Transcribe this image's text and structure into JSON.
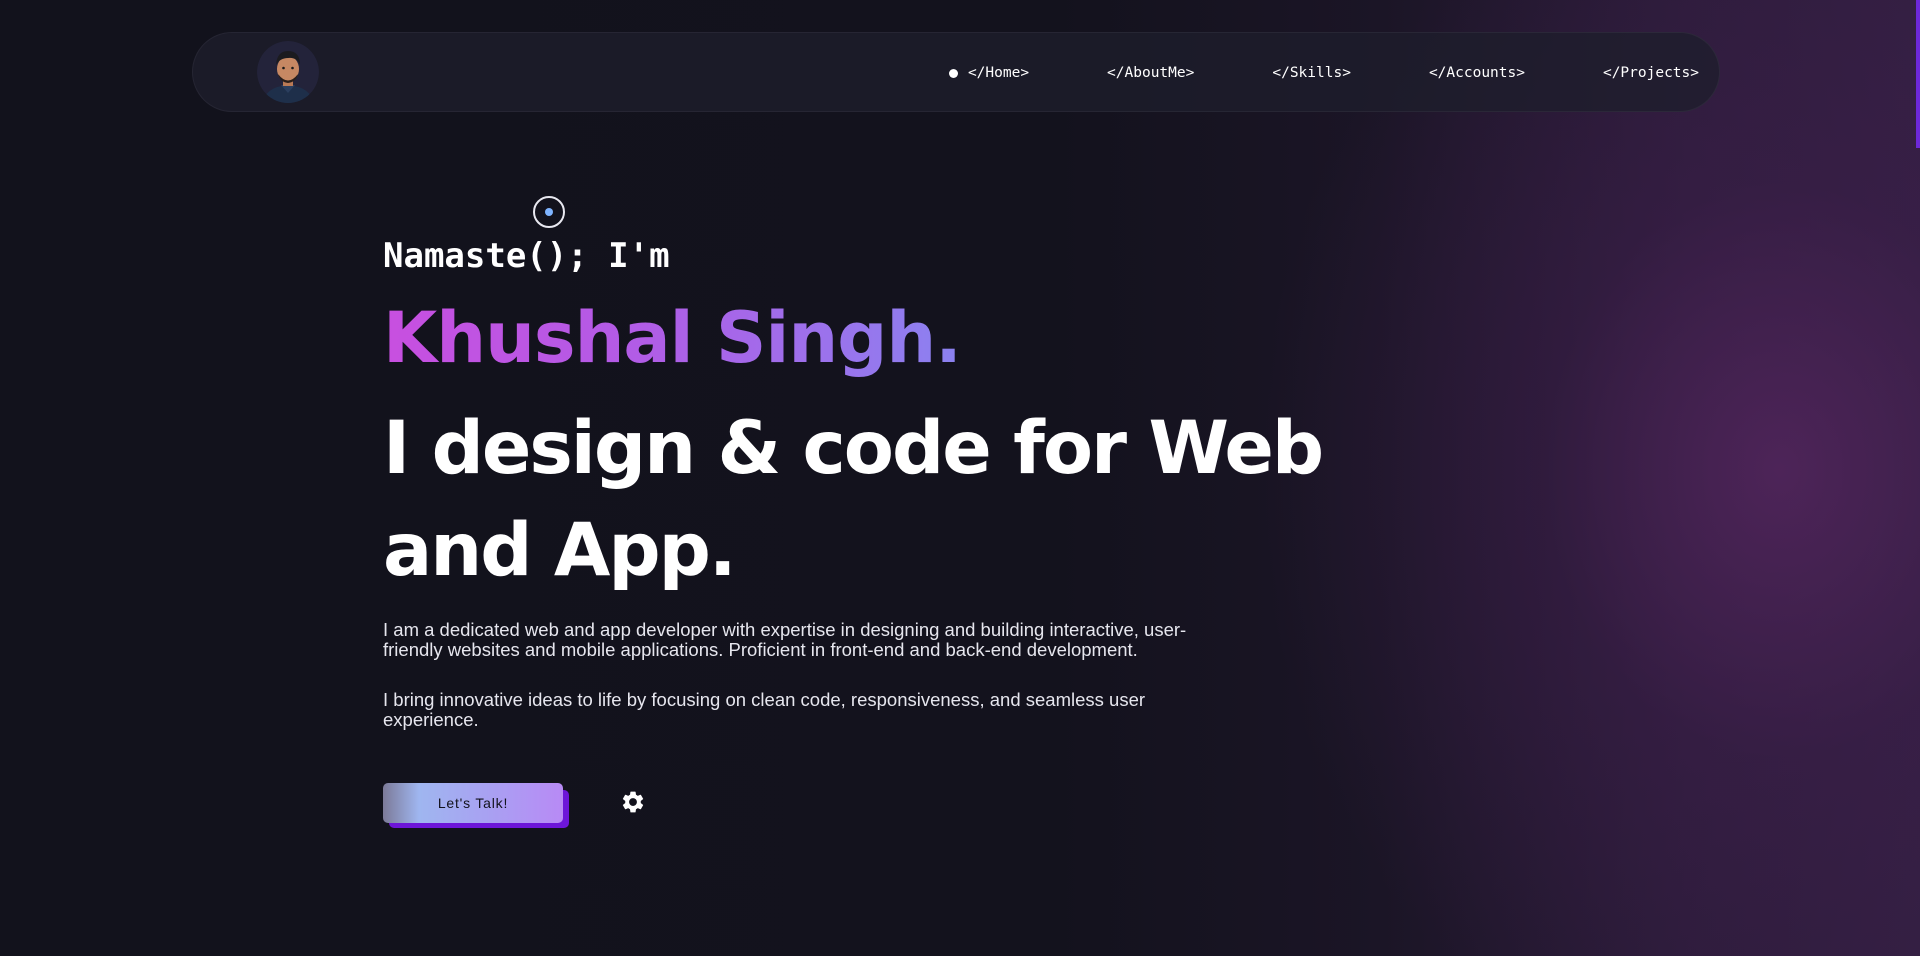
{
  "nav": {
    "avatar_alt": "Khushal Singh avatar",
    "links": [
      {
        "label": "</Home>",
        "active": true
      },
      {
        "label": "</AboutMe>",
        "active": false
      },
      {
        "label": "</Skills>",
        "active": false
      },
      {
        "label": "</Accounts>",
        "active": false
      },
      {
        "label": "</Projects>",
        "active": false
      }
    ]
  },
  "hero": {
    "greeting": "Namaste(); I'm",
    "name": "Khushal Singh.",
    "headline": "I design & code for Web and App.",
    "paragraphs": [
      "I am a dedicated web and app developer with expertise in designing and building interactive, user-friendly websites and mobile applications. Proficient in front-end and back-end development.",
      "I bring innovative ideas to life by focusing on clean code, responsiveness, and seamless user experience."
    ],
    "cta_label": "Let's Talk!",
    "settings_icon": "gear-icon"
  },
  "colors": {
    "background": "#12121c",
    "accent_purple": "#6d16d8",
    "name_gradient_start": "#c84fe0",
    "name_gradient_end": "#8b82f0"
  }
}
